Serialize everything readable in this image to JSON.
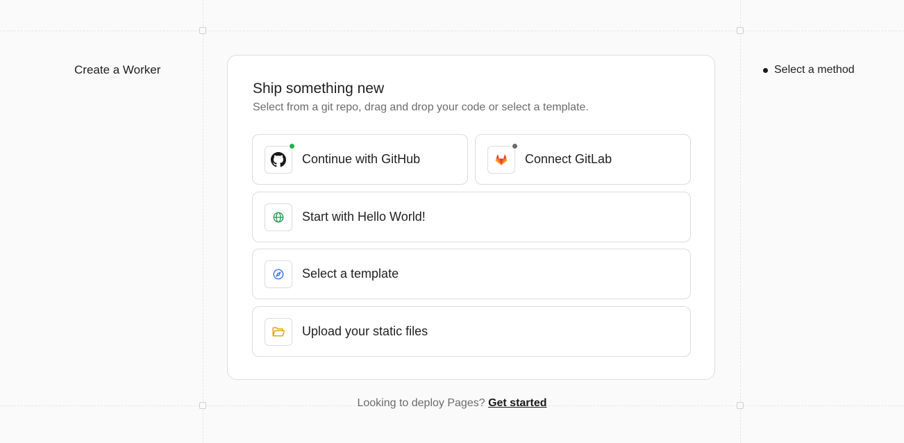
{
  "page": {
    "title": "Create a Worker"
  },
  "steps": [
    {
      "label": "Select a method"
    }
  ],
  "card": {
    "title": "Ship something new",
    "subtitle": "Select from a git repo, drag and drop your code or select a template."
  },
  "options": {
    "github": {
      "label": "Continue with GitHub",
      "icon": "github-icon",
      "status_color": "#22b14c"
    },
    "gitlab": {
      "label": "Connect GitLab",
      "icon": "gitlab-icon",
      "status_color": "#6b6b6b"
    },
    "hello_world": {
      "label": "Start with Hello World!",
      "icon": "globe-icon",
      "icon_color": "#1f9d55"
    },
    "template": {
      "label": "Select a template",
      "icon": "compass-icon",
      "icon_color": "#2f6fe4"
    },
    "upload": {
      "label": "Upload your static files",
      "icon": "folder-open-icon",
      "icon_color": "#e0a100"
    }
  },
  "footer": {
    "text": "Looking to deploy Pages?",
    "link": "Get started"
  }
}
